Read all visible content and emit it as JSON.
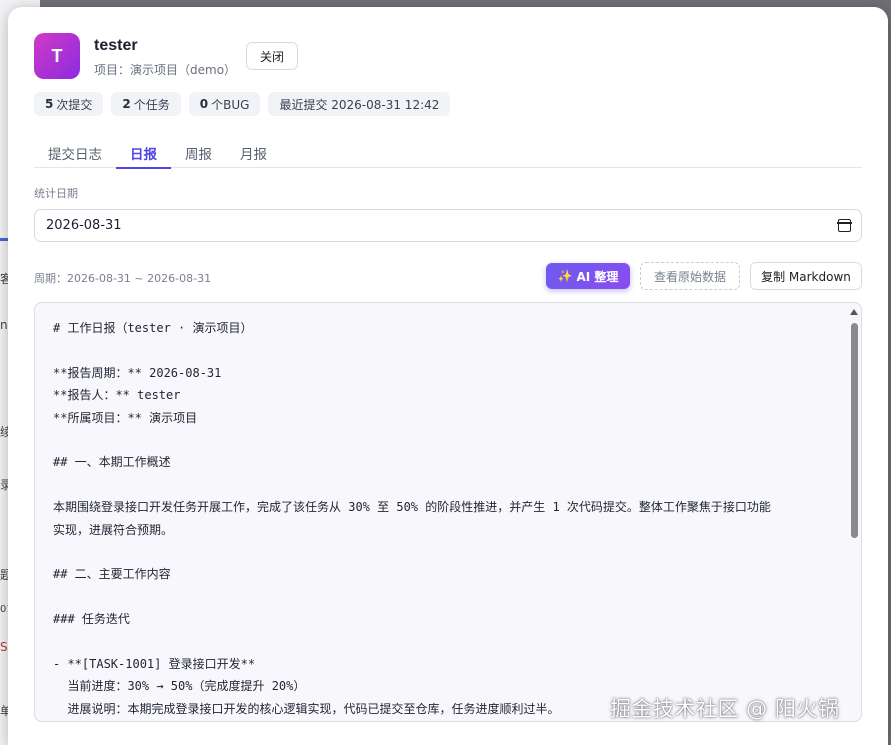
{
  "header": {
    "avatar_letter": "T",
    "user_name": "tester",
    "project_line": "项目：演示项目（demo）",
    "close_label": "关闭"
  },
  "stats": [
    {
      "num": "5",
      "label": "次提交"
    },
    {
      "num": "2",
      "label": "个任务"
    },
    {
      "num": "0",
      "label": "个BUG"
    },
    {
      "num": "",
      "label": "最近提交 2026-08-31 12:42"
    }
  ],
  "tabs": [
    {
      "label": "提交日志",
      "active": false
    },
    {
      "label": "日报",
      "active": true
    },
    {
      "label": "周报",
      "active": false
    },
    {
      "label": "月报",
      "active": false
    }
  ],
  "filter": {
    "date_label": "统计日期",
    "date_value": "2026-08-31",
    "period_text": "周期：2026-08-31 ~ 2026-08-31"
  },
  "actions": {
    "ai_label": "AI 整理",
    "raw_label": "查看原始数据",
    "copy_label": "复制 Markdown"
  },
  "report_lines": [
    "# 工作日报（tester · 演示项目）",
    "",
    "**报告周期：** 2026-08-31",
    "**报告人：** tester",
    "**所属项目：** 演示项目",
    "",
    "## 一、本期工作概述",
    "",
    "本期围绕登录接口开发任务开展工作，完成了该任务从 30% 至 50% 的阶段性推进，并产生 1 次代码提交。整体工作聚焦于接口功能",
    "实现，进展符合预期。",
    "",
    "## 二、主要工作内容",
    "",
    "### 任务迭代",
    "",
    "- **[TASK-1001] 登录接口开发**",
    "  当前进度：30% → 50%（完成度提升 20%）",
    "  进展说明：本期完成登录接口开发的核心逻辑实现，代码已提交至仓库，任务进度顺利过半。"
  ],
  "watermark": "掘金技术社区 @ 阳火锅",
  "background_fragments": [
    "客",
    "n",
    "绫",
    "录",
    "题",
    "01",
    "S",
    "单"
  ]
}
